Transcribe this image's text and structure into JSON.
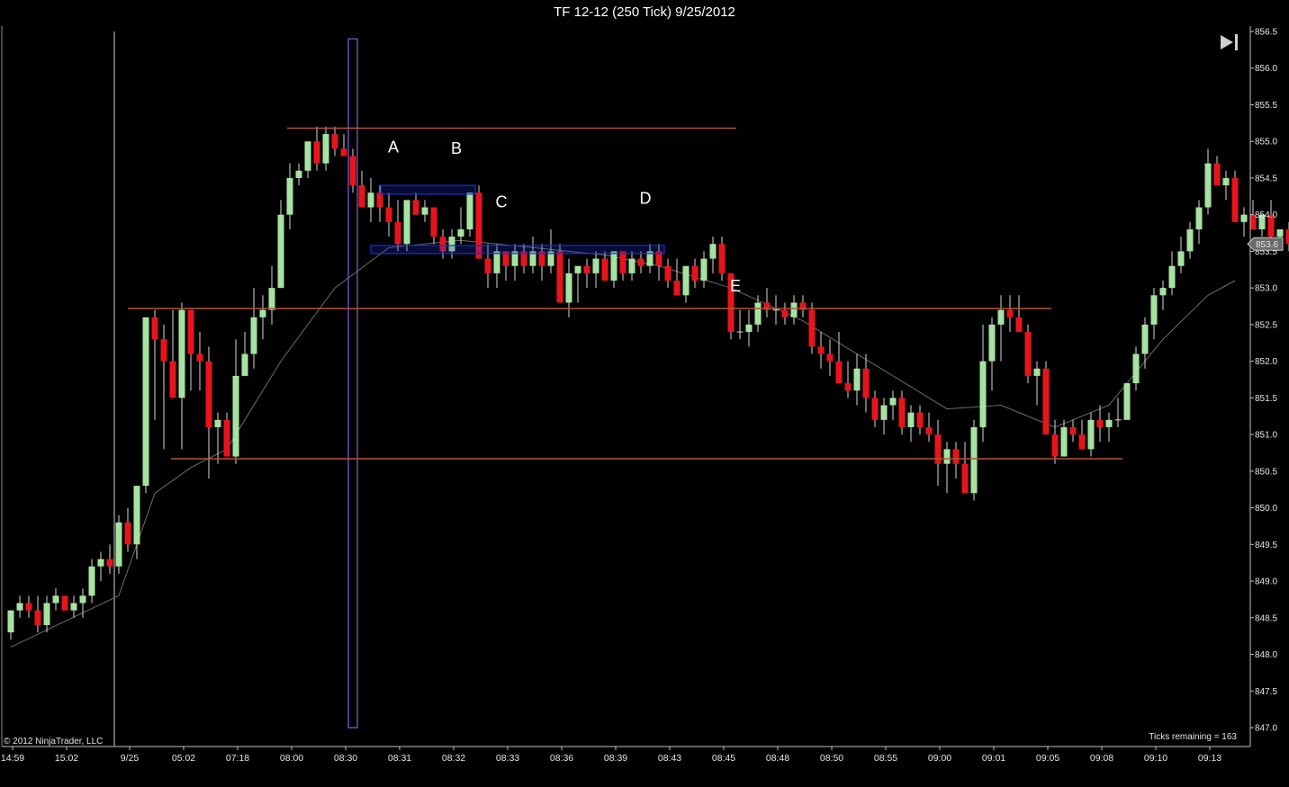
{
  "window": {
    "title": "TF 12-12 (250 Tick)  9/25/2012",
    "copyright": "© 2012 NinjaTrader, LLC",
    "ticks_remaining": "Ticks remaining = 163",
    "scroll_end_icon": "scroll-to-end-icon"
  },
  "colors": {
    "background": "#000000",
    "up_candle": "#a6e3a2",
    "down_candle": "#e8141c",
    "wick": "#d8d8d8",
    "sma": "#6c6c6c",
    "hline": "#b4543a",
    "box": "#1b2fd0",
    "session_bar": "#6a4ab0",
    "axis": "#bfbfbf",
    "price_label_bg": "#6b6b6b"
  },
  "chart_data": {
    "type": "candlestick",
    "instrument": "TF 12-12",
    "interval": "250 Tick",
    "date": "9/25/2012",
    "ylim": [
      847.0,
      856.5
    ],
    "y_ticks": [
      "856.5",
      "856.0",
      "855.5",
      "855.0",
      "854.5",
      "854.0",
      "853.5",
      "853.0",
      "852.5",
      "852.0",
      "851.5",
      "851.0",
      "850.5",
      "850.0",
      "849.5",
      "849.0",
      "848.5",
      "848.0",
      "847.5",
      "847.0"
    ],
    "x_ticks": [
      {
        "bar": 0,
        "label": "14:59"
      },
      {
        "bar": 6,
        "label": "15:02"
      },
      {
        "bar": 13,
        "label": "9/25"
      },
      {
        "bar": 19,
        "label": "05:02"
      },
      {
        "bar": 25,
        "label": "07:18"
      },
      {
        "bar": 31,
        "label": "08:00"
      },
      {
        "bar": 37,
        "label": "08:30"
      },
      {
        "bar": 43,
        "label": "08:31"
      },
      {
        "bar": 49,
        "label": "08:32"
      },
      {
        "bar": 55,
        "label": "08:33"
      },
      {
        "bar": 61,
        "label": "08:36"
      },
      {
        "bar": 67,
        "label": "08:39"
      },
      {
        "bar": 73,
        "label": "08:43"
      },
      {
        "bar": 79,
        "label": "08:45"
      },
      {
        "bar": 85,
        "label": "08:48"
      },
      {
        "bar": 91,
        "label": "08:50"
      },
      {
        "bar": 97,
        "label": "08:55"
      },
      {
        "bar": 103,
        "label": "09:00"
      },
      {
        "bar": 109,
        "label": "09:01"
      },
      {
        "bar": 115,
        "label": "09:05"
      },
      {
        "bar": 121,
        "label": "09:08"
      },
      {
        "bar": 127,
        "label": "09:10"
      },
      {
        "bar": 133,
        "label": "09:13"
      }
    ],
    "bars": [
      [
        848.3,
        848.6,
        848.2,
        848.6
      ],
      [
        848.6,
        848.8,
        848.5,
        848.7
      ],
      [
        848.7,
        848.8,
        848.5,
        848.6
      ],
      [
        848.6,
        848.8,
        848.3,
        848.4
      ],
      [
        848.4,
        848.8,
        848.3,
        848.7
      ],
      [
        848.7,
        848.9,
        848.6,
        848.8
      ],
      [
        848.8,
        848.8,
        848.6,
        848.6
      ],
      [
        848.6,
        848.8,
        848.5,
        848.7
      ],
      [
        848.7,
        848.9,
        848.5,
        848.8
      ],
      [
        848.8,
        849.3,
        848.7,
        849.2
      ],
      [
        849.2,
        849.4,
        849.0,
        849.3
      ],
      [
        849.3,
        849.5,
        849.1,
        849.2
      ],
      [
        849.2,
        849.9,
        849.1,
        849.8
      ],
      [
        849.8,
        850.0,
        849.4,
        849.5
      ],
      [
        849.5,
        850.3,
        849.3,
        850.3
      ],
      [
        850.3,
        852.6,
        850.2,
        852.6
      ],
      [
        852.6,
        852.7,
        851.2,
        852.3
      ],
      [
        852.3,
        852.5,
        850.8,
        852.0
      ],
      [
        852.0,
        852.7,
        851.6,
        851.5
      ],
      [
        851.5,
        852.8,
        850.8,
        852.7
      ],
      [
        852.7,
        852.7,
        851.6,
        852.1
      ],
      [
        852.1,
        852.4,
        851.6,
        852.0
      ],
      [
        852.0,
        852.2,
        850.4,
        851.1
      ],
      [
        851.1,
        851.3,
        850.6,
        851.2
      ],
      [
        851.2,
        851.3,
        850.7,
        850.7
      ],
      [
        850.7,
        852.3,
        850.6,
        851.8
      ],
      [
        851.8,
        852.4,
        851.8,
        852.1
      ],
      [
        852.1,
        853.0,
        851.9,
        852.6
      ],
      [
        852.6,
        852.9,
        852.3,
        852.7
      ],
      [
        852.7,
        853.3,
        852.5,
        853.0
      ],
      [
        853.0,
        854.2,
        853.0,
        854.0
      ],
      [
        854.0,
        854.7,
        853.8,
        854.5
      ],
      [
        854.5,
        854.7,
        854.4,
        854.6
      ],
      [
        854.6,
        855.0,
        854.5,
        855.0
      ],
      [
        855.0,
        855.2,
        854.6,
        854.7
      ],
      [
        854.7,
        855.2,
        854.6,
        855.1
      ],
      [
        855.1,
        855.2,
        854.8,
        854.9
      ],
      [
        854.9,
        855.1,
        854.8,
        854.8
      ],
      [
        854.8,
        854.9,
        854.3,
        854.4
      ],
      [
        854.4,
        854.6,
        854.1,
        854.1
      ],
      [
        854.1,
        854.5,
        853.9,
        854.3
      ],
      [
        854.3,
        854.4,
        853.9,
        854.1
      ],
      [
        854.1,
        854.3,
        853.7,
        853.9
      ],
      [
        853.9,
        854.2,
        853.5,
        853.6
      ],
      [
        853.6,
        854.2,
        853.5,
        854.2
      ],
      [
        854.2,
        854.3,
        854.0,
        854.0
      ],
      [
        854.0,
        854.2,
        853.9,
        854.1
      ],
      [
        854.1,
        854.1,
        853.6,
        853.7
      ],
      [
        853.7,
        853.8,
        853.4,
        853.5
      ],
      [
        853.5,
        853.8,
        853.4,
        853.7
      ],
      [
        853.7,
        854.1,
        853.6,
        853.8
      ],
      [
        853.8,
        854.3,
        853.7,
        854.3
      ],
      [
        854.3,
        854.4,
        853.4,
        853.4
      ],
      [
        853.4,
        853.6,
        853.0,
        853.2
      ],
      [
        853.2,
        853.6,
        853.0,
        853.5
      ],
      [
        853.5,
        853.5,
        853.1,
        853.3
      ],
      [
        853.3,
        853.6,
        853.1,
        853.5
      ],
      [
        853.5,
        853.6,
        853.2,
        853.3
      ],
      [
        853.3,
        853.7,
        853.2,
        853.5
      ],
      [
        853.5,
        853.6,
        853.1,
        853.3
      ],
      [
        853.3,
        853.8,
        853.2,
        853.5
      ],
      [
        853.5,
        853.6,
        852.8,
        852.8
      ],
      [
        852.8,
        853.4,
        852.6,
        853.2
      ],
      [
        853.2,
        853.3,
        852.8,
        853.3
      ],
      [
        853.3,
        853.4,
        853.0,
        853.2
      ],
      [
        853.2,
        853.5,
        853.0,
        853.4
      ],
      [
        853.4,
        853.5,
        853.1,
        853.1
      ],
      [
        853.1,
        853.5,
        853.0,
        853.5
      ],
      [
        853.5,
        853.5,
        853.1,
        853.2
      ],
      [
        853.2,
        853.5,
        853.1,
        853.4
      ],
      [
        853.4,
        853.5,
        853.2,
        853.3
      ],
      [
        853.3,
        853.6,
        853.2,
        853.5
      ],
      [
        853.5,
        853.6,
        853.1,
        853.3
      ],
      [
        853.3,
        853.4,
        853.0,
        853.1
      ],
      [
        853.1,
        853.4,
        852.9,
        852.9
      ],
      [
        852.9,
        853.3,
        852.8,
        853.3
      ],
      [
        853.3,
        853.4,
        853.0,
        853.1
      ],
      [
        853.1,
        853.5,
        853.0,
        853.4
      ],
      [
        853.4,
        853.7,
        853.2,
        853.6
      ],
      [
        853.6,
        853.7,
        853.1,
        853.2
      ],
      [
        853.2,
        853.2,
        852.3,
        852.4
      ],
      [
        852.4,
        852.7,
        852.3,
        852.4
      ],
      [
        852.4,
        852.7,
        852.2,
        852.5
      ],
      [
        852.5,
        852.9,
        852.4,
        852.8
      ],
      [
        852.8,
        853.0,
        852.6,
        852.7
      ],
      [
        852.7,
        852.9,
        852.5,
        852.7
      ],
      [
        852.7,
        852.8,
        852.5,
        852.6
      ],
      [
        852.6,
        852.9,
        852.5,
        852.8
      ],
      [
        852.8,
        852.9,
        852.6,
        852.7
      ],
      [
        852.7,
        852.8,
        852.1,
        852.2
      ],
      [
        852.2,
        852.4,
        851.9,
        852.1
      ],
      [
        852.1,
        852.3,
        851.8,
        852.0
      ],
      [
        852.0,
        852.4,
        851.8,
        851.7
      ],
      [
        851.7,
        852.0,
        851.5,
        851.6
      ],
      [
        851.6,
        852.1,
        851.4,
        851.9
      ],
      [
        851.9,
        852.1,
        851.3,
        851.5
      ],
      [
        851.5,
        851.6,
        851.1,
        851.2
      ],
      [
        851.2,
        851.5,
        851.0,
        851.4
      ],
      [
        851.4,
        851.6,
        851.2,
        851.5
      ],
      [
        851.5,
        851.6,
        851.0,
        851.1
      ],
      [
        851.1,
        851.4,
        850.9,
        851.3
      ],
      [
        851.3,
        851.4,
        851.0,
        851.1
      ],
      [
        851.1,
        851.3,
        850.9,
        851.0
      ],
      [
        851.0,
        851.2,
        850.3,
        850.6
      ],
      [
        850.6,
        850.9,
        850.2,
        850.8
      ],
      [
        850.8,
        850.9,
        850.4,
        850.6
      ],
      [
        850.6,
        850.9,
        850.2,
        850.2
      ],
      [
        850.2,
        851.2,
        850.1,
        851.1
      ],
      [
        851.1,
        852.5,
        850.9,
        852.0
      ],
      [
        852.0,
        852.6,
        851.6,
        852.5
      ],
      [
        852.5,
        852.9,
        852.0,
        852.7
      ],
      [
        852.7,
        852.9,
        852.4,
        852.6
      ],
      [
        852.6,
        852.9,
        852.4,
        852.4
      ],
      [
        852.4,
        852.5,
        851.7,
        851.8
      ],
      [
        851.8,
        852.0,
        851.4,
        851.9
      ],
      [
        851.9,
        852.0,
        851.1,
        851.0
      ],
      [
        851.0,
        851.2,
        850.6,
        850.7
      ],
      [
        850.7,
        851.2,
        850.7,
        851.1
      ],
      [
        851.1,
        851.2,
        850.9,
        851.0
      ],
      [
        851.0,
        851.2,
        850.8,
        850.8
      ],
      [
        850.8,
        851.3,
        850.7,
        851.2
      ],
      [
        851.2,
        851.4,
        850.9,
        851.1
      ],
      [
        851.1,
        851.3,
        850.9,
        851.2
      ],
      [
        851.2,
        851.5,
        851.1,
        851.2
      ],
      [
        851.2,
        851.7,
        851.2,
        851.7
      ],
      [
        851.7,
        852.2,
        851.6,
        852.1
      ],
      [
        852.1,
        852.6,
        851.9,
        852.5
      ],
      [
        852.5,
        853.0,
        852.3,
        852.9
      ],
      [
        852.9,
        853.1,
        852.7,
        853.0
      ],
      [
        853.0,
        853.5,
        852.9,
        853.3
      ],
      [
        853.3,
        853.7,
        853.2,
        853.5
      ],
      [
        853.5,
        853.9,
        853.4,
        853.8
      ],
      [
        853.8,
        854.2,
        853.6,
        854.1
      ],
      [
        854.1,
        854.9,
        854.0,
        854.7
      ],
      [
        854.7,
        854.8,
        854.4,
        854.4
      ],
      [
        854.4,
        854.6,
        854.2,
        854.5
      ],
      [
        854.5,
        854.6,
        853.9,
        853.9
      ],
      [
        853.9,
        854.1,
        853.7,
        854.0
      ],
      [
        854.0,
        854.2,
        853.8,
        853.8
      ],
      [
        853.8,
        854.0,
        853.7,
        854.0
      ],
      [
        854.0,
        854.2,
        853.6,
        853.7
      ],
      [
        853.7,
        853.8,
        853.6,
        853.8
      ],
      [
        853.8,
        853.9,
        853.5,
        853.6
      ]
    ],
    "sma": [
      [
        0,
        848.1
      ],
      [
        12,
        848.8
      ],
      [
        16,
        850.2
      ],
      [
        20,
        850.55
      ],
      [
        24,
        850.8
      ],
      [
        30,
        852.0
      ],
      [
        36,
        853.0
      ],
      [
        42,
        853.55
      ],
      [
        50,
        853.65
      ],
      [
        58,
        853.55
      ],
      [
        66,
        853.45
      ],
      [
        72,
        853.3
      ],
      [
        80,
        853.0
      ],
      [
        88,
        852.55
      ],
      [
        96,
        851.95
      ],
      [
        104,
        851.35
      ],
      [
        110,
        851.4
      ],
      [
        116,
        851.1
      ],
      [
        122,
        851.4
      ],
      [
        128,
        852.3
      ],
      [
        133,
        852.9
      ],
      [
        136,
        853.1
      ]
    ],
    "hlines": [
      {
        "price": 855.18,
        "bar_start": 30.7,
        "bar_end": 80.6
      },
      {
        "price": 852.72,
        "bar_start": 13.0,
        "bar_end": 115.6
      },
      {
        "price": 850.67,
        "bar_start": 17.8,
        "bar_end": 123.5
      }
    ],
    "boxes": [
      {
        "bar_start": 41.1,
        "bar_end": 51.6,
        "price_low": 854.28,
        "price_high": 854.4
      },
      {
        "bar_start": 40.0,
        "bar_end": 72.6,
        "price_low": 853.47,
        "price_high": 853.58
      }
    ],
    "session_bar": {
      "bar_start": 38.0,
      "bar_end": 39.0,
      "price_low": 847.0,
      "price_high": 856.4
    },
    "session_line_bar": 12.0,
    "markers": [
      {
        "label": "A",
        "bar": 42.5,
        "price": 854.85
      },
      {
        "label": "B",
        "bar": 49.5,
        "price": 854.83
      },
      {
        "label": "C",
        "bar": 54.5,
        "price": 854.1
      },
      {
        "label": "D",
        "bar": 70.5,
        "price": 854.15
      },
      {
        "label": "E",
        "bar": 80.5,
        "price": 852.95
      }
    ],
    "last_price": "853.6"
  }
}
